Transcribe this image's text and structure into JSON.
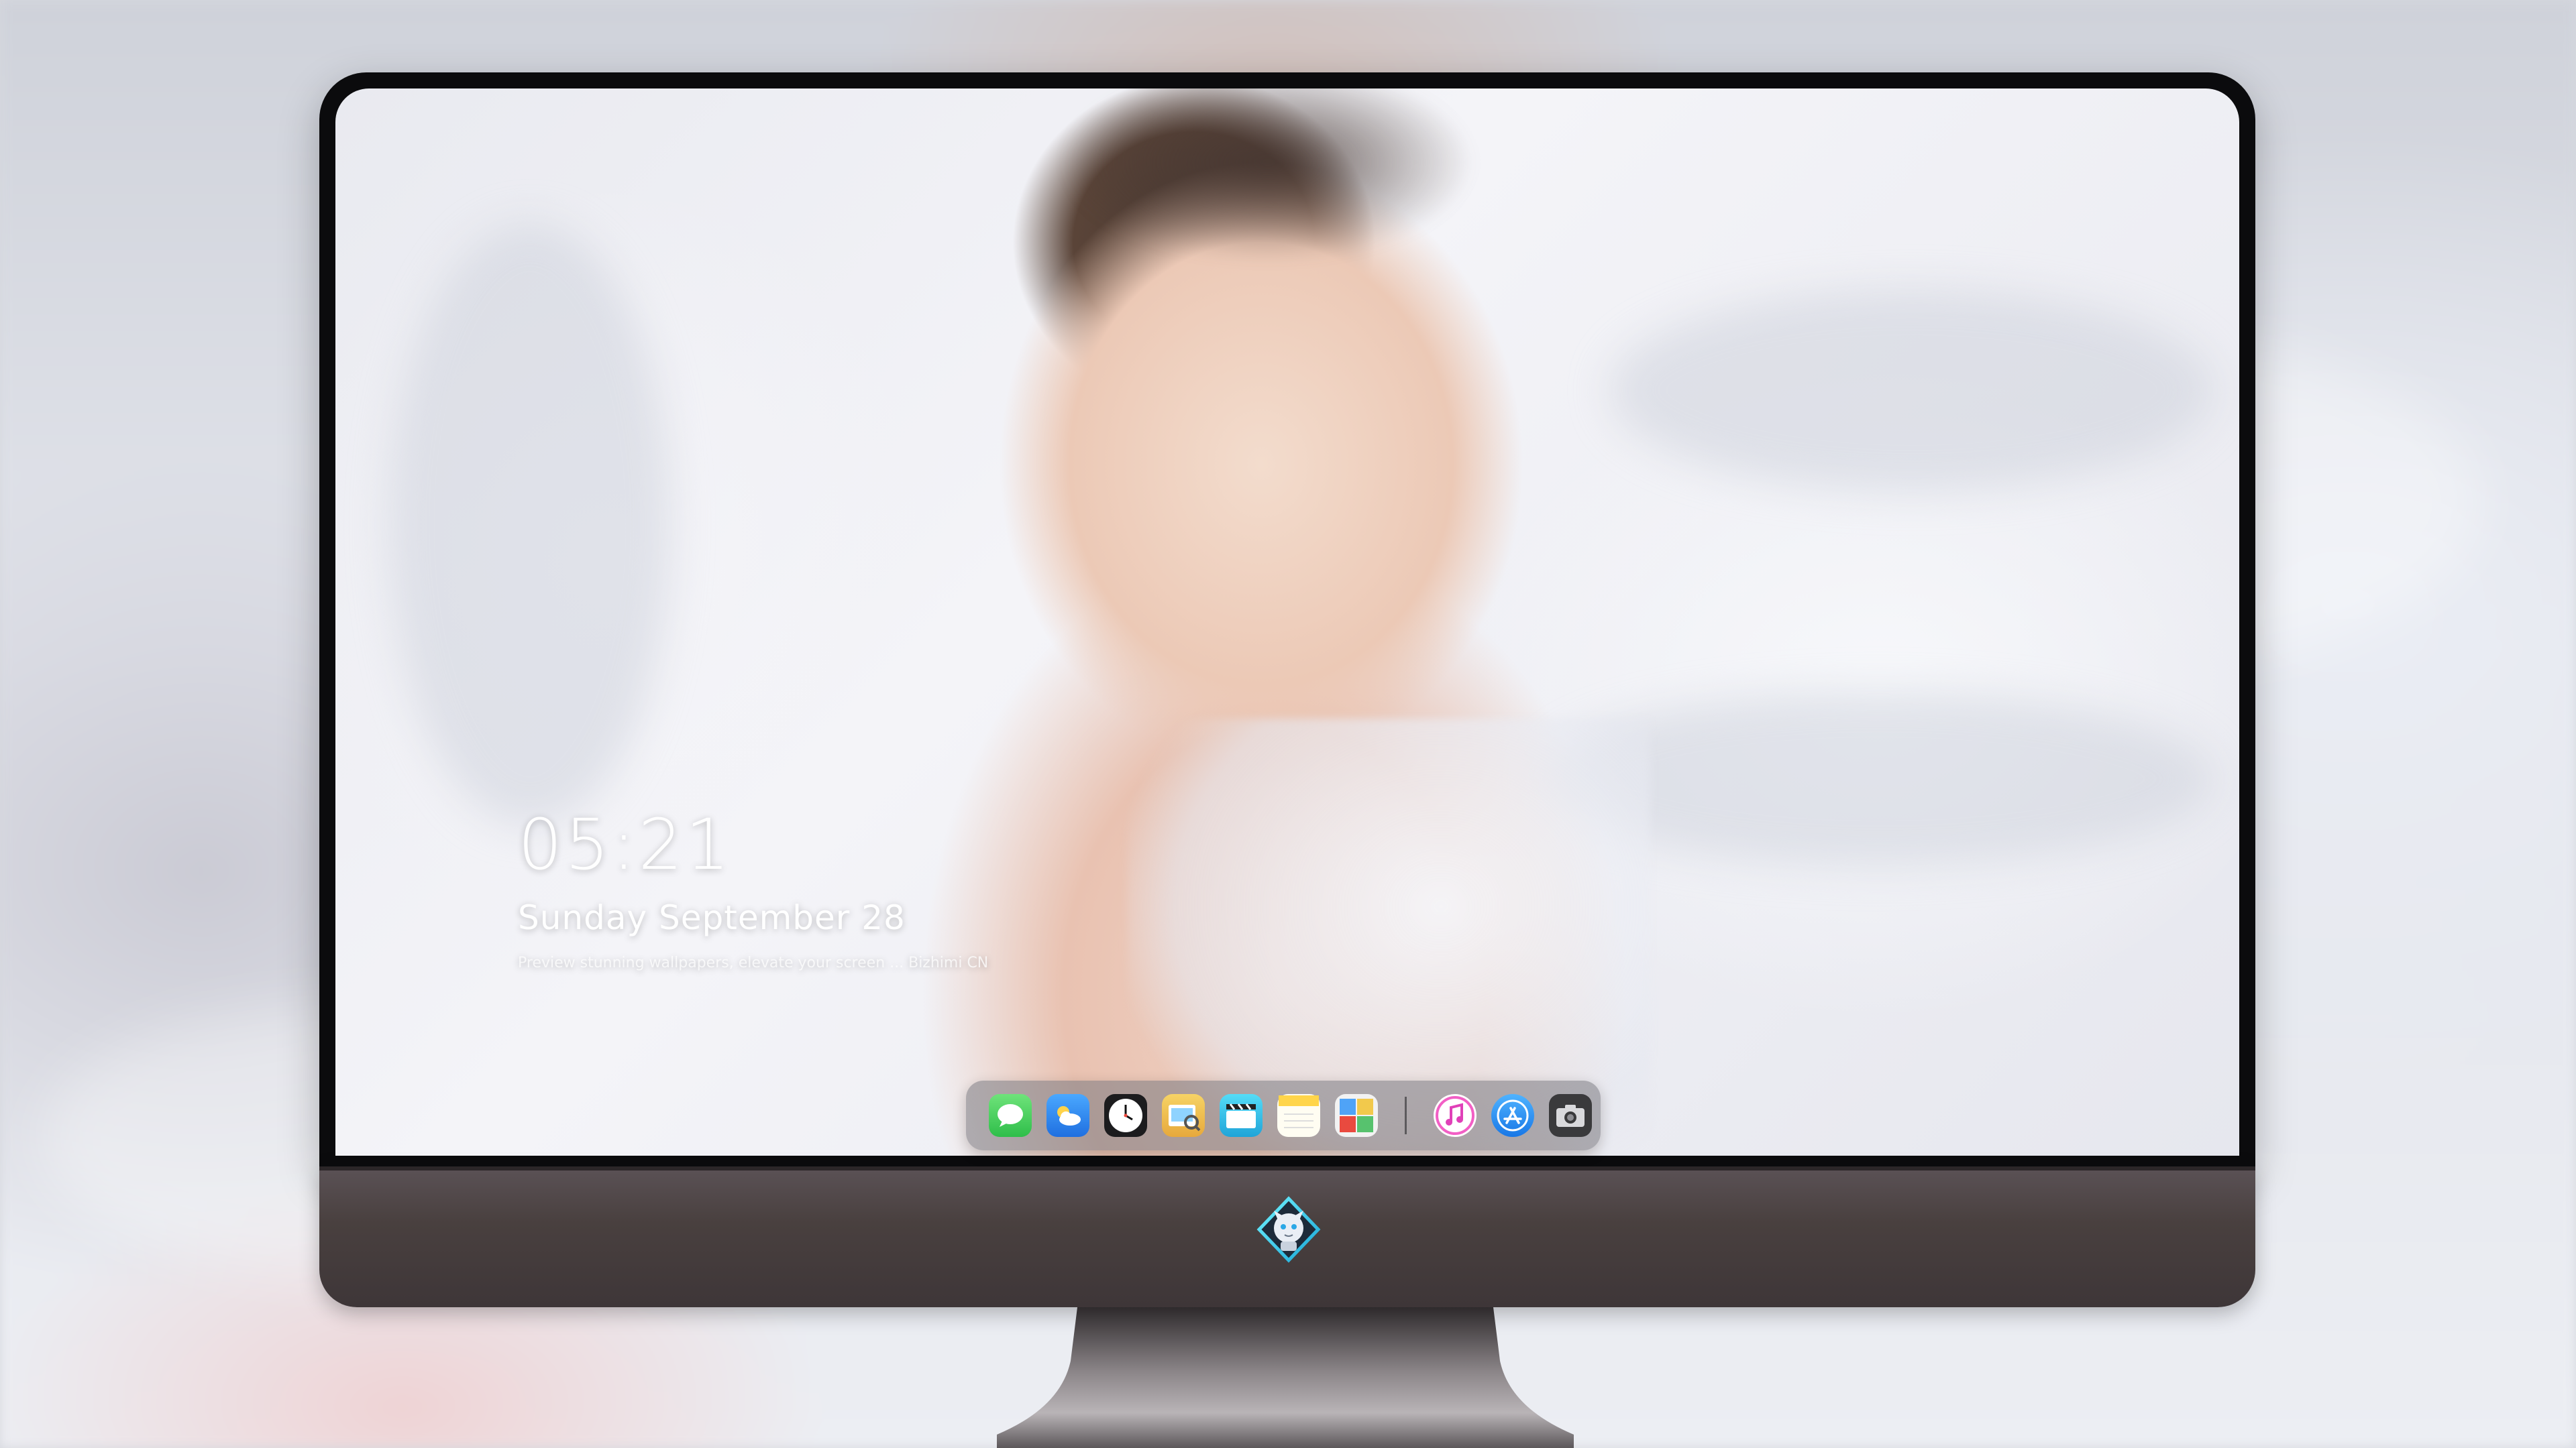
{
  "lock_screen": {
    "time": "05:21",
    "date": "Sunday September  28",
    "caption": "Preview stunning wallpapers, elevate your screen ... Bizhimi CN"
  },
  "dock": {
    "apps": [
      {
        "name": "Messages",
        "icon": "messages-icon",
        "color": "#34c759"
      },
      {
        "name": "Weather",
        "icon": "weather-icon",
        "color": "#2f8ff5"
      },
      {
        "name": "Clock",
        "icon": "clock-icon",
        "color": "#1c1c1e"
      },
      {
        "name": "Preview",
        "icon": "preview-icon",
        "color": "#f2c94c"
      },
      {
        "name": "Clips",
        "icon": "clapper-icon",
        "color": "#3ac8f0"
      },
      {
        "name": "Notes",
        "icon": "notes-icon",
        "color": "#ffd54a"
      },
      {
        "name": "Photo Booth",
        "icon": "photo-booth-icon",
        "color": "#e94a3f"
      },
      {
        "name": "Music",
        "icon": "music-icon",
        "color": "#fa57c1"
      },
      {
        "name": "App Store",
        "icon": "app-store-icon",
        "color": "#1e8cf5"
      },
      {
        "name": "Screenshot",
        "icon": "camera-icon",
        "color": "#3a3a3c"
      }
    ]
  },
  "monitor": {
    "logo": "bizhimi-robot-logo"
  }
}
